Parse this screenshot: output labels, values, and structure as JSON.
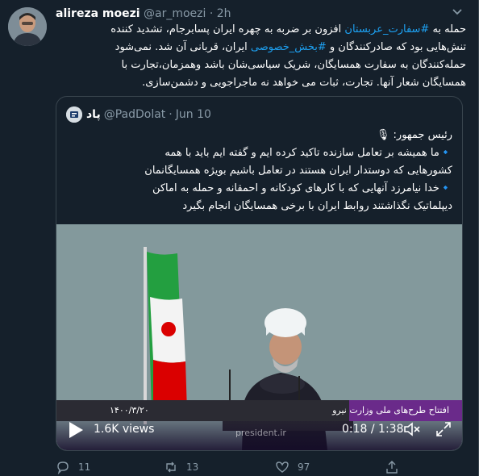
{
  "author": {
    "name": "alireza moezi",
    "handle": "@ar_moezi",
    "separator": "·",
    "time": "2h"
  },
  "tweet": {
    "line1_pre": "حمله به ",
    "line1_link": "#سفارت_عربستان",
    "line1_post": " افزون بر ضربه به چهره ایران پسابرجام، تشدید کننده",
    "line2_pre": "تنش‌هایی بود که صادرکنندگان و ",
    "line2_link": "#بخش_خصوصی",
    "line2_post": " ایران، قربانی آن شد. نمی‌شود",
    "line3": "حمله‌کنندگان به سفارت همسایگان، شریک سیاسی‌شان باشد وهمزمان،تجارت با",
    "line4": "همسایگان شعار آنها. تجارت، ثبات می خواهد نه ماجراجویی و دشمن‌سازی."
  },
  "quote": {
    "name": "پاد",
    "handle": "@PadDolat",
    "separator": "·",
    "date": "Jun 10",
    "line1": "رئیس جمهور:",
    "line2": "ما همیشه بر تعامل سازنده تاکید کرده ایم و گفته ایم  باید با همه",
    "line3": "کشورهایی که دوستدار ایران هستند در تعامل باشیم بویژه همسایگانمان",
    "line4": "خدا نیامرزد آنهایی که با کارهای کودکانه و احمقانه و حمله به اماکن",
    "line5": "دیپلماتیک نگذاشتند روابط ایران با برخی همسایگان انجام بگیرد"
  },
  "video": {
    "views": "1.6K views",
    "duration": "0:18 / 1:38",
    "chyron_title": "افتتاح طرح‌های ملی وزارت نیرو",
    "chyron_date": "۱۴۰۰/۳/۲۰",
    "watermark": "president.ir"
  },
  "actions": {
    "reply_count": "11",
    "retweet_count": "13",
    "like_count": "97"
  },
  "colors": {
    "background": "#15202b",
    "link": "#1da1f2",
    "muted": "#8899a6",
    "border": "#38444d"
  }
}
